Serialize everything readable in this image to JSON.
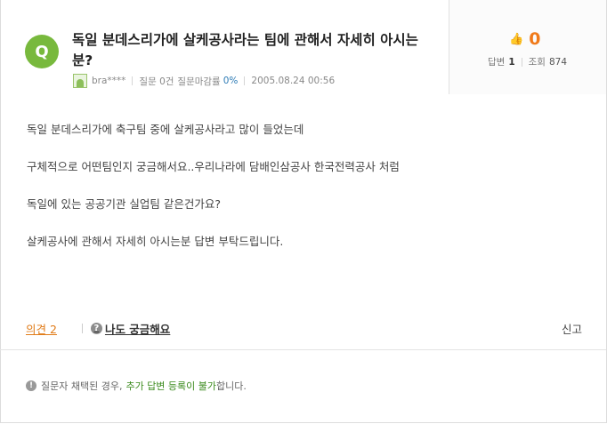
{
  "question": {
    "badge": "Q",
    "title": "독일 분데스리가에 살케공사라는 팀에 관해서 자세히 아시는분?",
    "author": "bra****",
    "question_count_text": "질문 0건",
    "close_rate_label": "질문마감률",
    "close_rate_value": "0%",
    "date": "2005.08.24 00:56"
  },
  "stats": {
    "score": "0",
    "answer_label": "답변",
    "answer_count": "1",
    "view_label": "조회",
    "view_count": "874"
  },
  "body": {
    "paragraphs": [
      "독일 분데스리가에 축구팀 중에 살케공사라고 많이 들었는데",
      "구체적으로 어떤팀인지 궁금해서요..우리나라에 담배인삼공사 한국전력공사 처럼",
      "독일에 있는 공공기관 실업팀 같은건가요?",
      "살케공사에 관해서 자세히 아시는분 답변 부탁드립니다."
    ]
  },
  "actions": {
    "opinion_label": "의견",
    "opinion_count": "2",
    "curious_label": "나도 궁금해요",
    "report_label": "신고"
  },
  "notice": {
    "prefix": "질문자 채택된 경우,",
    "highlight": "추가 답변 등록이 불가",
    "suffix": "합니다."
  },
  "colors": {
    "badge_green": "#78b93d",
    "score_orange": "#f07a1a",
    "link_orange": "#e07b18",
    "notice_green": "#3a8a1c",
    "rate_blue": "#2d7bb5"
  },
  "icons": [
    "question-badge-icon",
    "avatar-icon",
    "thumbs-up-icon",
    "question-mark-icon",
    "exclamation-icon"
  ]
}
